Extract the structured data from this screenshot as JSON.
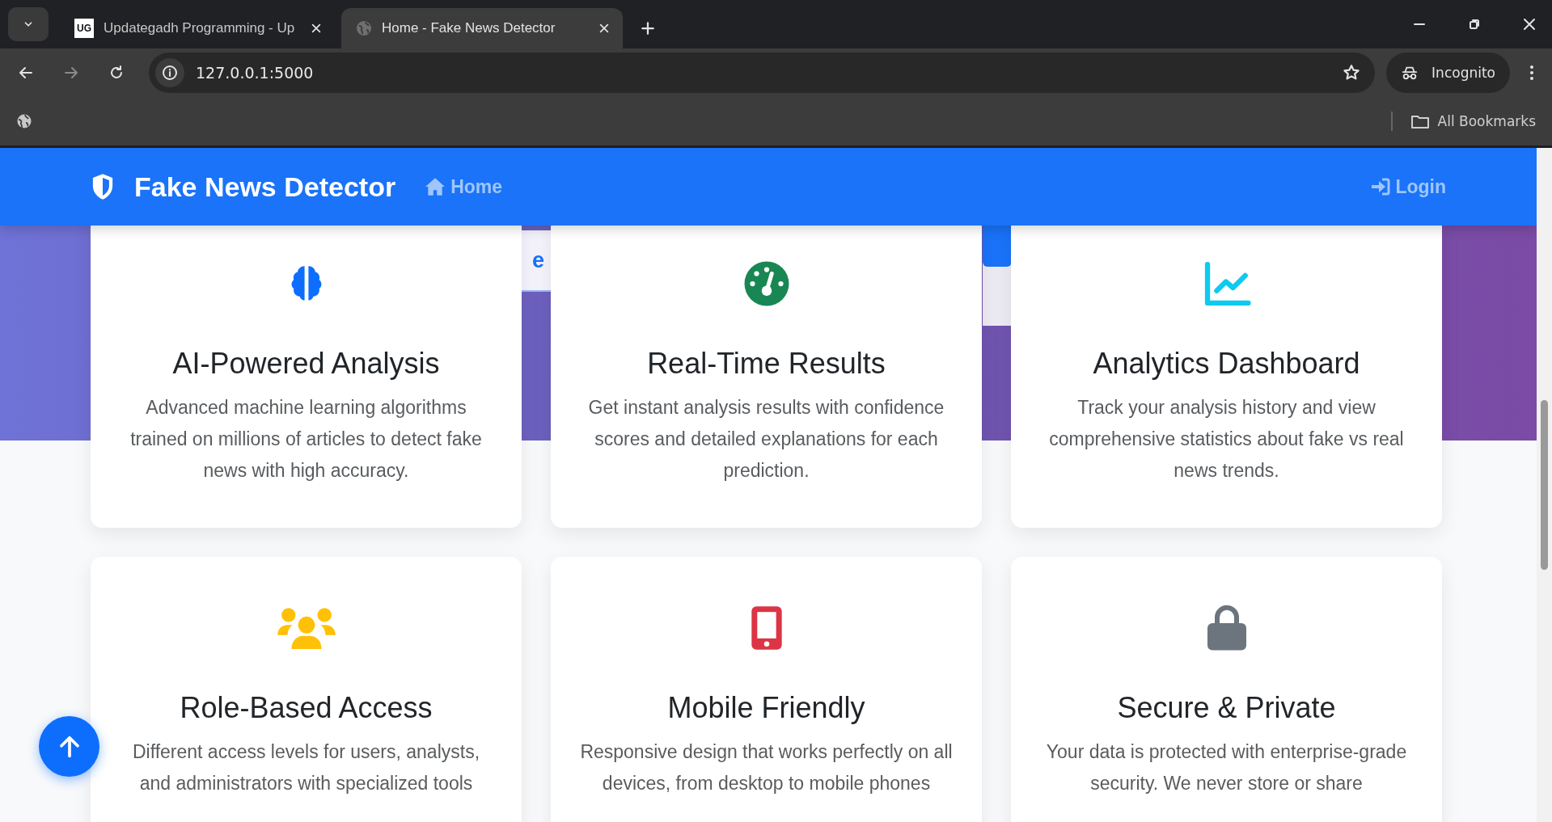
{
  "browser": {
    "tabs": [
      {
        "title": "Updategadh Programming - Up",
        "favicon": "UG",
        "selected": false
      },
      {
        "title": "Home - Fake News Detector",
        "selected": true
      }
    ],
    "address": "127.0.0.1:5000",
    "profile": "Incognito",
    "bookmarks": "All Bookmarks"
  },
  "navbar": {
    "brand": "Fake News Detector",
    "links": [
      {
        "label": "Home",
        "kind": "home"
      },
      {
        "label": "Login",
        "kind": "login"
      }
    ]
  },
  "hero": {
    "button_fragment": "e"
  },
  "features": [
    {
      "kind": "brain",
      "color": "#0d6efd",
      "title": "AI-Powered Analysis",
      "description": "Advanced machine learning algorithms trained on millions of articles to detect fake news with high accuracy."
    },
    {
      "kind": "gauge",
      "color": "#198754",
      "title": "Real-Time Results",
      "description": "Get instant analysis results with confidence scores and detailed explanations for each prediction."
    },
    {
      "kind": "chart",
      "color": "#0dcaf0",
      "title": "Analytics Dashboard",
      "description": "Track your analysis history and view comprehensive statistics about fake vs real news trends."
    },
    {
      "kind": "users",
      "color": "#ffc107",
      "title": "Role-Based Access",
      "description": "Different access levels for users, analysts, and administrators with specialized tools"
    },
    {
      "kind": "mobile",
      "color": "#dc3545",
      "title": "Mobile Friendly",
      "description": "Responsive design that works perfectly on all devices, from desktop to mobile phones"
    },
    {
      "kind": "lock",
      "color": "#6c757d",
      "title": "Secure & Private",
      "description": "Your data is protected with enterprise-grade security. We never store or share"
    }
  ]
}
